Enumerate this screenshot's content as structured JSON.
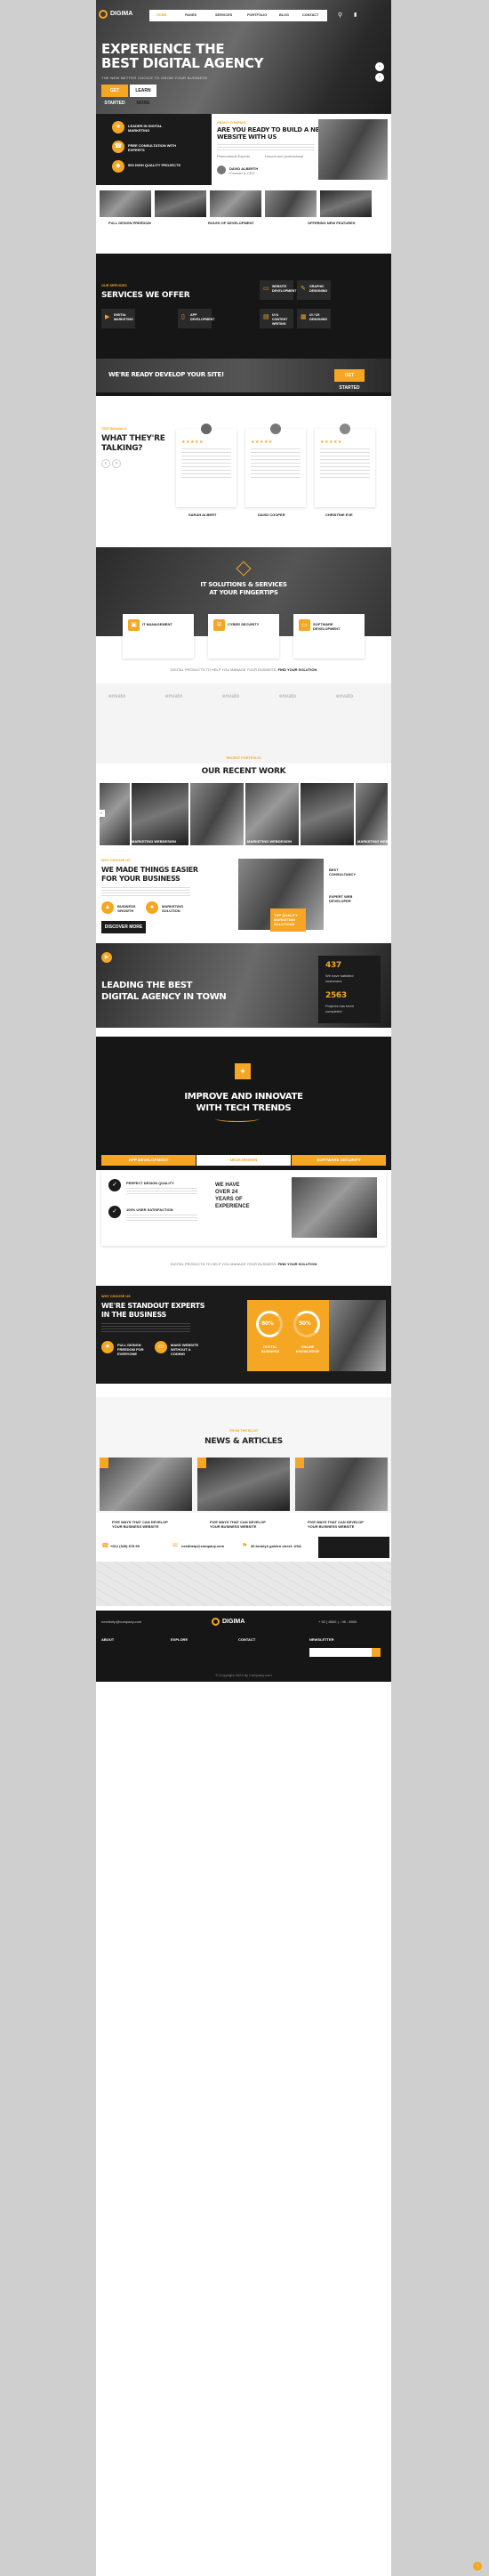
{
  "nav": {
    "logo": "DIGIMA",
    "items": [
      "HOME",
      "PAGES",
      "SERVICES",
      "PORTFOLIO",
      "BLOG",
      "CONTACT"
    ]
  },
  "hero": {
    "title_line1": "EXPERIENCE THE",
    "title_line2": "BEST DIGITAL AGENCY",
    "subtitle": "THE NEW BETTER CHOICE TO GROW YOUR BUSINESS",
    "btn_primary": "GET STARTED",
    "btn_secondary": "LEARN MORE"
  },
  "features": {
    "items": [
      {
        "label": "LEADER IN DIGITAL MARKETING"
      },
      {
        "label": "FREE CONSULTATION WITH EXPERTS"
      },
      {
        "label": "500 HIGH QUALITY PROJECTS"
      }
    ]
  },
  "about": {
    "eyebrow": "ABOUT COMPANY",
    "title_line1": "ARE YOU READY TO BUILD A NEW",
    "title_line2": "WEBSITE WITH US",
    "check1": "Phenomenal Experts",
    "check2": "Honest and professional",
    "author_name": "DAVID ALBERTH",
    "author_role": "Founder & CEO"
  },
  "gallery": {
    "labels": [
      "FULL DESIGN FREEDOM",
      "RULES OF DEVELOPMENT",
      "OFFERING NEW FEATURES"
    ]
  },
  "services": {
    "eyebrow": "OUR SERVICES",
    "title": "SERVICES WE OFFER",
    "items": [
      {
        "label": "WEBSITE DEVELOPMENT"
      },
      {
        "label": "GRAPHIC DESIGNING"
      },
      {
        "label": "DIGITAL MARKETING"
      },
      {
        "label": "APP DEVELOPMENT"
      },
      {
        "label": "UI & CONTENT WRITING"
      },
      {
        "label": "UI / UX DESIGNING"
      }
    ],
    "banner_text": "WE'RE READY DEVELOP YOUR SITE!",
    "banner_btn": "GET STARTED"
  },
  "testimonials": {
    "eyebrow": "TESTIMONIALS",
    "title_line1": "WHAT THEY'RE",
    "title_line2": "TALKING?",
    "people": [
      {
        "name": "SARAH ALBERT"
      },
      {
        "name": "DAVID COOPER"
      },
      {
        "name": "CHRISTINE EVE"
      }
    ]
  },
  "solutions": {
    "title_line1": "IT SOLUTIONS & SERVICES",
    "title_line2": "AT YOUR FINGERTIPS",
    "items": [
      {
        "label": "IT MANAGEMENT"
      },
      {
        "label": "CYBER SECURITY"
      },
      {
        "label": "SOFTWARE DEVELOPMENT"
      }
    ],
    "note_prefix": "DIGITAL PRODUCTS TO HELP YOU MANAGE YOUR BUSINESS.",
    "note_link": "FIND YOUR SOLUTION"
  },
  "partners": {
    "logos": [
      "envato",
      "envato",
      "envato",
      "envato",
      "envato"
    ]
  },
  "work": {
    "eyebrow": "RECENT PORTFOLIO",
    "title": "OUR RECENT WORK",
    "captions": [
      "MARKETING WEBDESIGN",
      "MARKETING WEBDESIGN",
      "MARKETING WEBDESIGN"
    ]
  },
  "easier": {
    "eyebrow": "WHY CHOOSE US",
    "title_line1": "WE MADE THINGS EASIER",
    "title_line2": "FOR YOUR BUSINESS",
    "f1": "BUSINESS GROWTH",
    "f2": "MARKETING SOLUTION",
    "btn": "DISCOVER MORE",
    "side1": "BEST CONSULTANCY",
    "side2": "EXPERT WEB DEVELOPER",
    "badge": "TOP QUALITY MARKETING SOLUTIONS"
  },
  "leading": {
    "title_line1": "LEADING THE BEST",
    "title_line2": "DIGITAL AGENCY IN TOWN",
    "stat1_value": "437",
    "stat1_label": "We have satisfied customers",
    "stat2_value": "2563",
    "stat2_label": "Projects has been completed"
  },
  "improve": {
    "title_line1": "IMPROVE AND INNOVATE",
    "title_line2": "WITH TECH TRENDS",
    "tabs": [
      "APP DEVELOPMENT",
      "UI/UX DESIGN",
      "SOFTWARE SECURITY"
    ],
    "check1": "PERFECT DESIGN QUALITY",
    "check2": "100% USER SATISFACTION",
    "years_line1": "WE HAVE",
    "years_line2": "OVER 24",
    "years_line3": "YEARS OF",
    "years_line4": "EXPERIENCE",
    "note_prefix": "DIGITAL PRODUCTS TO HELP YOU MANAGE YOUR BUSINESS.",
    "note_link": "FIND YOUR SOLUTION"
  },
  "experts": {
    "eyebrow": "WHY CHOOSE US",
    "title_line1": "WE'RE STANDOUT EXPERTS",
    "title_line2": "IN THE BUSINESS",
    "f1": "FULL DESIGN FREEDOM FOR EVERYONE",
    "f2": "MAKE WEBSITE WITHOUT A CODING",
    "p1_value": "80%",
    "p1_label": "DIGITAL BUSINESS",
    "p2_value": "50%",
    "p2_label": "ONLINE KNOWLEDGE"
  },
  "news": {
    "eyebrow": "FROM THE BLOG",
    "title": "NEWS & ARTICLES",
    "posts": [
      {
        "title": "FIVE WAYS THAT CAN DEVELOP YOUR BUSINESS WEBSITE"
      },
      {
        "title": "FIVE WAYS THAT CAN DEVELOP YOUR BUSINESS WEBSITE"
      },
      {
        "title": "FIVE WAYS THAT CAN DEVELOP YOUR BUSINESS WEBSITE"
      }
    ]
  },
  "contact": {
    "phone": "+012 (345) 678 99",
    "email": "needhelp@company.com",
    "address": "30 broklyn golden street. USA"
  },
  "footer": {
    "logo": "DIGIMA",
    "phone": "+ 92 ( 8800 ) - 98 - 8900",
    "email": "needhelp@company.com",
    "col_about": "ABOUT",
    "col_explore": "EXPLORE",
    "col_contact": "CONTACT",
    "col_news": "NEWSLETTER",
    "copyright": "© Copyright 2023 by Company.com"
  },
  "colors": {
    "accent": "#f5a623",
    "dark": "#1b1b1b"
  }
}
